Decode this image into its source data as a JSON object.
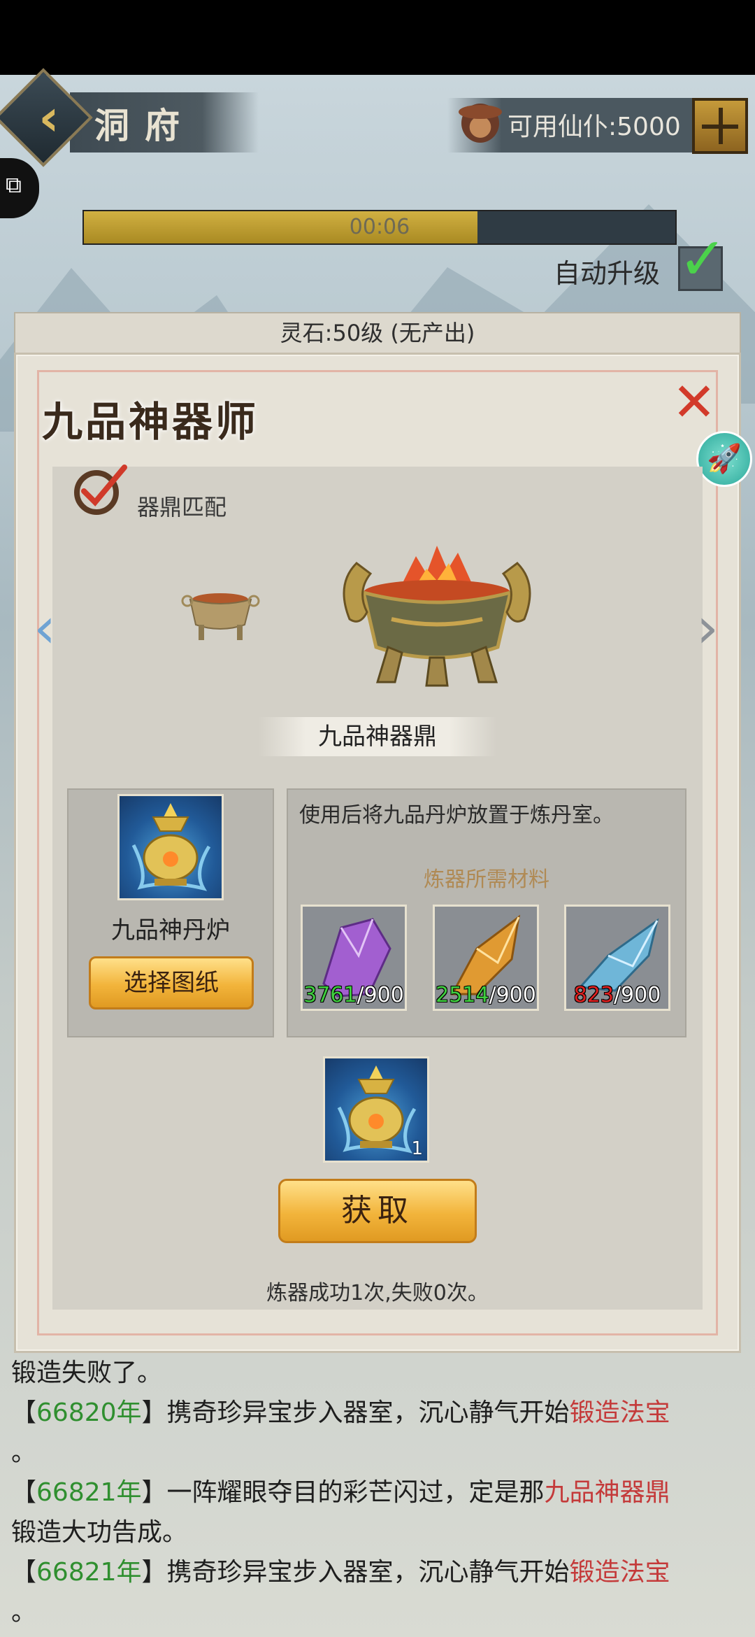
{
  "header": {
    "title": "洞府",
    "currency_label": "可用仙仆:5000"
  },
  "progress": {
    "time_text": "00:06",
    "fill_fraction": 0.665
  },
  "auto_upgrade": {
    "label": "自动升级",
    "checked": true
  },
  "behind_strip": {
    "text": "灵石:50级 (无产出)"
  },
  "modal": {
    "title": "九品神器师",
    "match_label": "器鼎匹配",
    "cauldron_name": "九品神器鼎",
    "furnace_name": "九品神丹炉",
    "select_button": "选择图纸",
    "description": "使用后将九品丹炉放置于炼丹室。",
    "materials_title": "炼器所需材料",
    "materials": [
      {
        "have": "3761",
        "need": "/900",
        "color": "#a25fd0"
      },
      {
        "have": "2514",
        "need": "/900",
        "color": "#e09a32"
      },
      {
        "have": "823",
        "need": "/900",
        "color": "#6fb6d8"
      }
    ],
    "reward_qty": "1",
    "get_button": "获取",
    "stats": "炼器成功1次,失败0次。"
  },
  "log": {
    "lines": [
      {
        "pre": "锻造失败了。",
        "year": "",
        "mid": "",
        "red": "",
        "post": ""
      },
      {
        "pre": "【",
        "year": "66820年",
        "mid": "】携奇珍异宝步入器室，沉心静气开始",
        "red": "锻造法宝",
        "post": ""
      },
      {
        "pre": "。",
        "year": "",
        "mid": "",
        "red": "",
        "post": ""
      },
      {
        "pre": "【",
        "year": "66821年",
        "mid": "】一阵耀眼夺目的彩芒闪过，定是那",
        "red": "九品神器鼎",
        "post": ""
      },
      {
        "pre": "锻造大功告成。",
        "year": "",
        "mid": "",
        "red": "",
        "post": ""
      },
      {
        "pre": "【",
        "year": "66821年",
        "mid": "】携奇珍异宝步入器室，沉心静气开始",
        "red": "锻造法宝",
        "post": ""
      },
      {
        "pre": "。",
        "year": "",
        "mid": "",
        "red": "",
        "post": ""
      }
    ]
  }
}
